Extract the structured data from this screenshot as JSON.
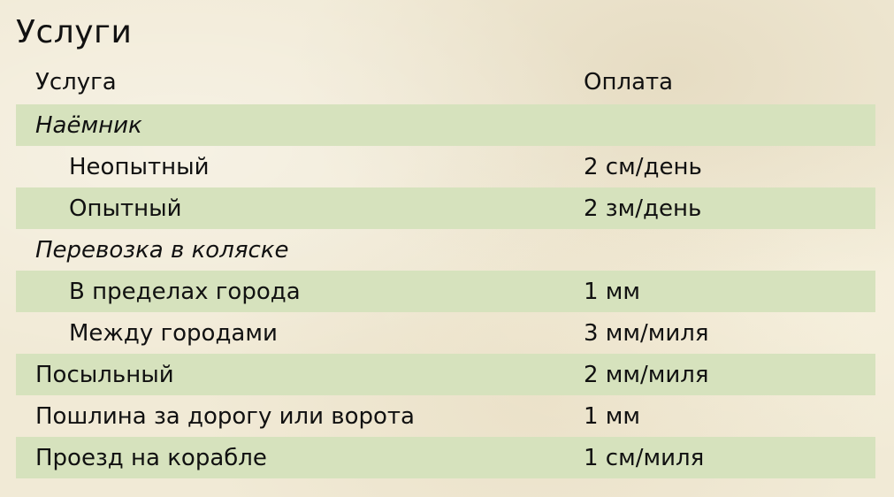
{
  "title": "Услуги",
  "table": {
    "columns": [
      "Услуга",
      "Оплата"
    ],
    "rows": [
      {
        "service": "Наёмник",
        "price": "",
        "kind": "group"
      },
      {
        "service": "Неопытный",
        "price": "2 см/день",
        "kind": "sub"
      },
      {
        "service": "Опытный",
        "price": "2 зм/день",
        "kind": "sub"
      },
      {
        "service": "Перевозка в коляске",
        "price": "",
        "kind": "group"
      },
      {
        "service": "В пределах города",
        "price": "1 мм",
        "kind": "sub"
      },
      {
        "service": "Между городами",
        "price": "3 мм/миля",
        "kind": "sub"
      },
      {
        "service": "Посыльный",
        "price": "2 мм/миля",
        "kind": "item"
      },
      {
        "service": "Пошлина за дорогу или ворота",
        "price": "1 мм",
        "kind": "item"
      },
      {
        "service": "Проезд на корабле",
        "price": "1 см/миля",
        "kind": "item"
      }
    ]
  },
  "colors": {
    "row_stripe": "#d6e2bd",
    "background": "#f1ead6",
    "text": "#111111"
  }
}
